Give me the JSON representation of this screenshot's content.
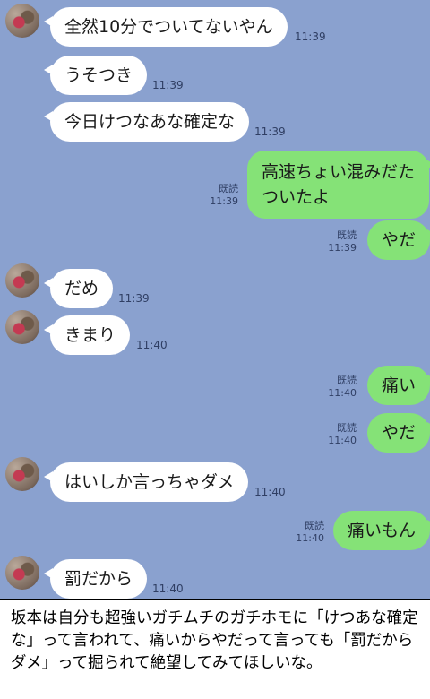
{
  "messages": [
    {
      "text": "全然10分でついてないやん",
      "time": "11:39"
    },
    {
      "text": "うそつき",
      "time": "11:39"
    },
    {
      "text": "今日けつなあな確定な",
      "time": "11:39"
    },
    {
      "text_line1": "高速ちょい混みだた",
      "text_line2": "ついたよ",
      "read": "既読",
      "time": "11:39"
    },
    {
      "text": "やだ",
      "read": "既読",
      "time": "11:39"
    },
    {
      "text": "だめ",
      "time": "11:39"
    },
    {
      "text": "きまり",
      "time": "11:40"
    },
    {
      "text": "痛い",
      "read": "既読",
      "time": "11:40"
    },
    {
      "text": "やだ",
      "read": "既読",
      "time": "11:40"
    },
    {
      "text": "はいしか言っちゃダメ",
      "time": "11:40"
    },
    {
      "text": "痛いもん",
      "read": "既読",
      "time": "11:40"
    },
    {
      "text": "罰だから",
      "time": "11:40"
    }
  ],
  "caption": "坂本は自分も超強いガチムチのガチホモに「けつあな確定な」って言われて、痛いからやだって言っても「罰だからダメ」って掘られて絶望してみてほしいな。",
  "colors": {
    "background": "#8aa1cf",
    "outgoing": "#85e277",
    "incoming": "#ffffff"
  }
}
